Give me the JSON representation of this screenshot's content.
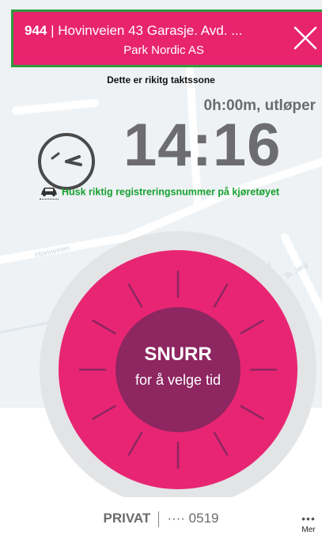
{
  "header": {
    "zone_number": "944",
    "separator": "|",
    "zone_address": "Hovinveien 43 Garasje. Avd. ...",
    "operator": "Park Nordic AS"
  },
  "zone_note": "Dette er rikitg taktssone",
  "duration": "0h:00m, utløper",
  "end_time": "14:16",
  "reminder": "Husk riktig registreringsnummer på kjøretøyet",
  "dial": {
    "title": "SNURR",
    "subtitle": "for å velge tid"
  },
  "account": {
    "type": "PRIVAT",
    "card": "···· 0519"
  },
  "more": {
    "dots": "•••",
    "label": "Mer"
  },
  "map_labels": [
    "Hovinveien",
    "St. Jørg"
  ],
  "colors": {
    "brand_pink": "#e8246f",
    "dial_center": "#8d2661",
    "highlight_border": "#2f9a3e",
    "reminder_green": "#17a02f"
  }
}
